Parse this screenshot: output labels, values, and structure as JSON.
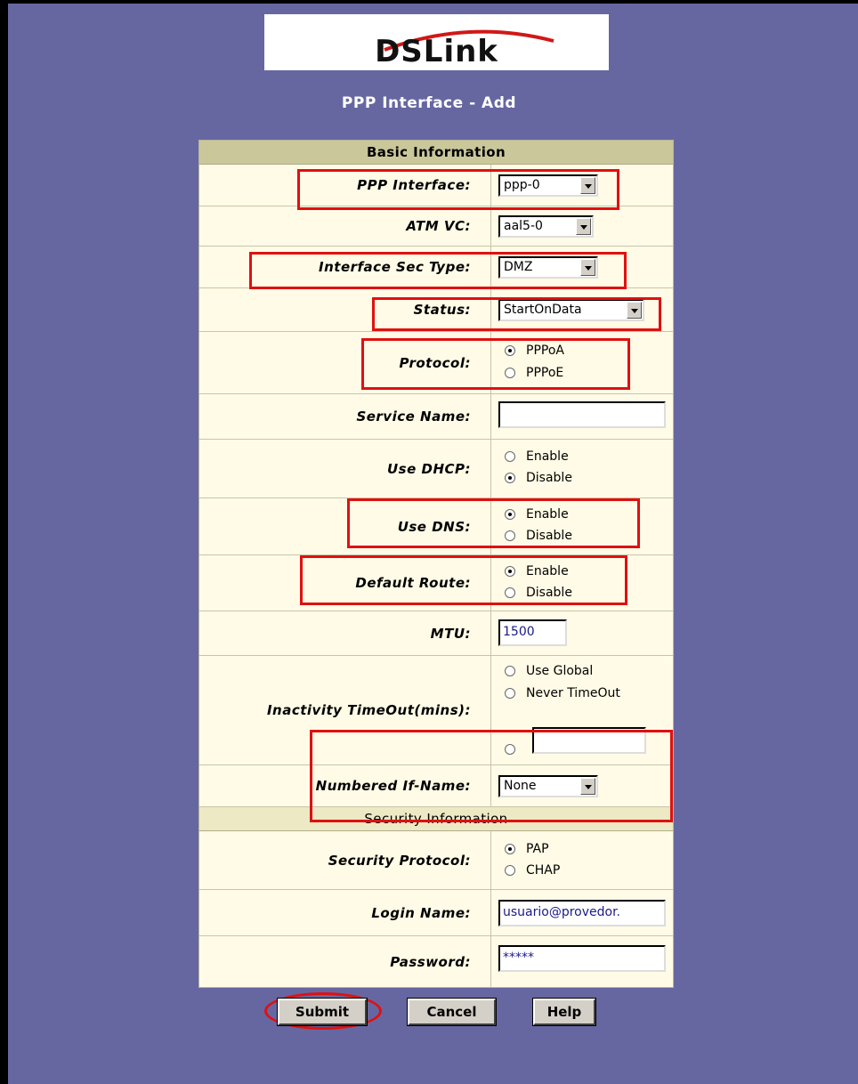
{
  "logo": {
    "text": "DSLink"
  },
  "page_title": "PPP Interface - Add",
  "basic_header": "Basic Information",
  "fields": {
    "ppp_interface": {
      "label": "PPP Interface:",
      "value": "ppp-0"
    },
    "atm_vc": {
      "label": "ATM VC:",
      "value": "aal5-0"
    },
    "sec_type": {
      "label": "Interface Sec Type:",
      "value": "DMZ"
    },
    "status": {
      "label": "Status:",
      "value": "StartOnData"
    },
    "protocol": {
      "label": "Protocol:",
      "options": [
        "PPPoA",
        "PPPoE"
      ],
      "selected": "PPPoA"
    },
    "service_name": {
      "label": "Service Name:",
      "value": ""
    },
    "use_dhcp": {
      "label": "Use DHCP:",
      "options": [
        "Enable",
        "Disable"
      ],
      "selected": "Disable"
    },
    "use_dns": {
      "label": "Use DNS:",
      "options": [
        "Enable",
        "Disable"
      ],
      "selected": "Enable"
    },
    "default_route": {
      "label": "Default Route:",
      "options": [
        "Enable",
        "Disable"
      ],
      "selected": "Enable"
    },
    "mtu": {
      "label": "MTU:",
      "value": "1500"
    },
    "inactivity": {
      "label": "Inactivity TimeOut(mins):",
      "options": [
        "Use Global",
        "Never TimeOut"
      ],
      "custom_value": ""
    },
    "numbered_if": {
      "label": "Numbered If-Name:",
      "value": "None"
    }
  },
  "security_header": "Security Information",
  "security": {
    "protocol": {
      "label": "Security Protocol:",
      "options": [
        "PAP",
        "CHAP"
      ],
      "selected": "PAP"
    },
    "login": {
      "label": "Login Name:",
      "value": "usuario@provedor."
    },
    "password": {
      "label": "Password:",
      "value": "*****"
    }
  },
  "buttons": {
    "submit": "Submit",
    "cancel": "Cancel",
    "help": "Help"
  },
  "colors": {
    "background": "#6667a0",
    "table_bg": "#fffbe6",
    "header_bg": "#cac79b",
    "highlight": "#e01010"
  }
}
